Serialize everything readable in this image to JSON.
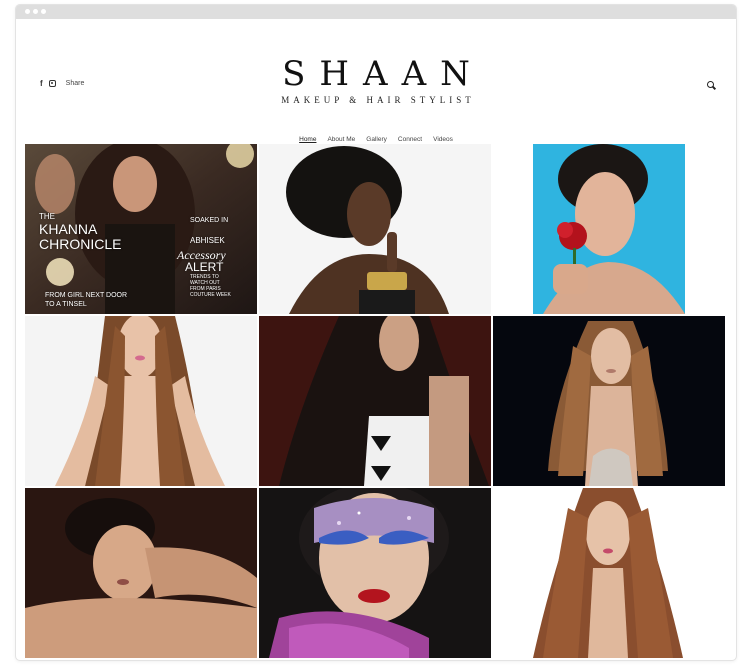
{
  "brand": {
    "title": "SHAAN",
    "subtitle": "MAKEUP & HAIR STYLIST"
  },
  "header": {
    "share_label": "Share",
    "icons": [
      "facebook-icon",
      "instagram-icon",
      "search-icon"
    ]
  },
  "nav": {
    "items": [
      {
        "label": "Home",
        "active": true
      },
      {
        "label": "About Me",
        "active": false
      },
      {
        "label": "Gallery",
        "active": false
      },
      {
        "label": "Connect",
        "active": false
      },
      {
        "label": "Videos",
        "active": false
      }
    ]
  },
  "magazine": {
    "line1": "THE",
    "line2": "KHANNA",
    "line3": "CHRONICLE",
    "right1": "SOAKED IN",
    "right2": "ABHISEK",
    "right3": "Accessory",
    "right4": "ALERT",
    "right5": "TRENDS TO",
    "right6": "WATCH OUT",
    "right7": "FROM PARIS",
    "right8": "COUTURE WEEK",
    "bottom1": "FROM GIRL NEXT DOOR",
    "bottom2": "TO A TINSEL"
  },
  "colors": {
    "accent": "#111111",
    "chrome": "#dedede"
  }
}
